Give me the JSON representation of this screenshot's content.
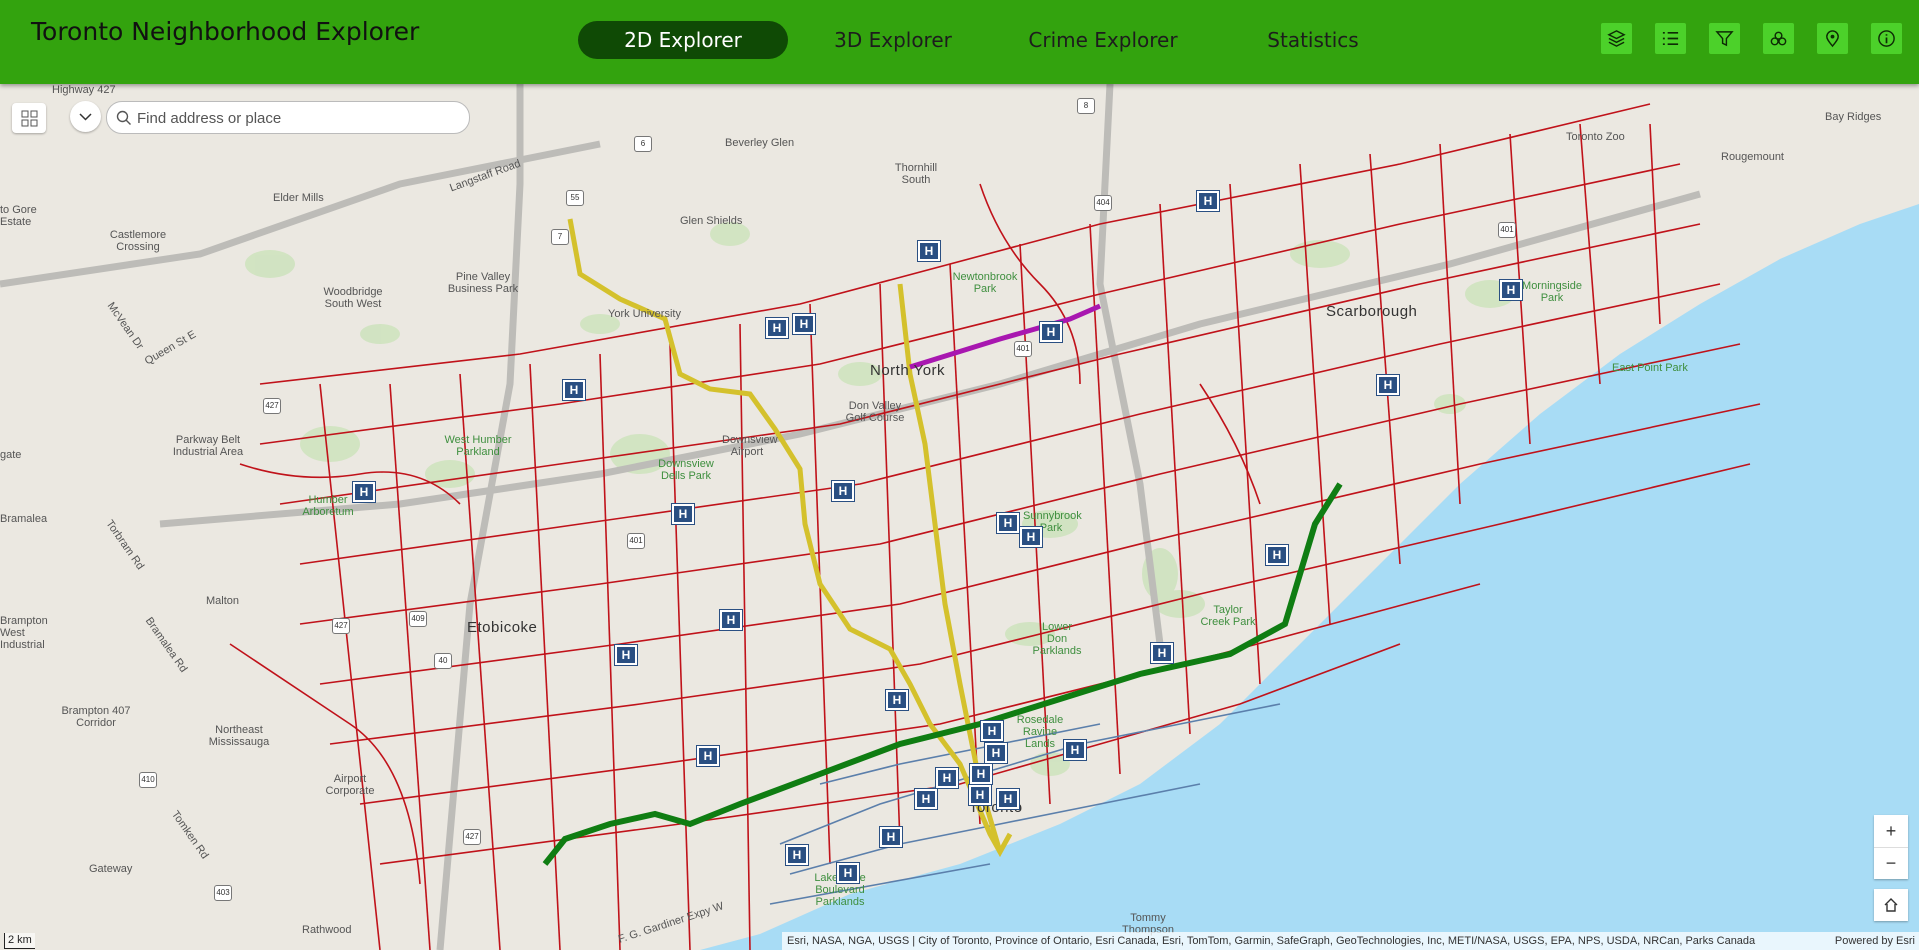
{
  "header": {
    "title": "Toronto Neighborhood Explorer",
    "tabs": [
      {
        "label": "2D Explorer",
        "active": true
      },
      {
        "label": "3D Explorer",
        "active": false
      },
      {
        "label": "Crime Explorer",
        "active": false
      },
      {
        "label": "Statistics",
        "active": false
      }
    ],
    "tools": [
      "layers-icon",
      "list-icon",
      "filter-icon",
      "cluster-icon",
      "location-pin-icon",
      "info-icon"
    ]
  },
  "search": {
    "placeholder": "Find address or place"
  },
  "zoom": {
    "in_label": "+",
    "out_label": "−"
  },
  "scale": {
    "label": "2 km"
  },
  "attribution": {
    "text": "Esri, NASA, NGA, USGS | City of Toronto, Province of Ontario, Esri Canada, Esri, TomTom, Garmin, SafeGraph, GeoTechnologies, Inc, METI/NASA, USGS, EPA, NPS, USDA, NRCan, Parks Canada",
    "powered": "Powered by Esri"
  },
  "map_labels": {
    "toronto_zoo": "Toronto Zoo",
    "bay_ridges": "Bay Ridges",
    "rougemount": "Rougemount",
    "scarborough": "Scarborough",
    "north_york": "North York",
    "etobicoke": "Etobicoke",
    "toronto": "Toronto",
    "bramalea": "Bramalea",
    "malton": "Malton",
    "elder_mills": "Elder Mills",
    "castlemore": "Castlemore Crossing",
    "woodbridge": "Woodbridge South West",
    "pine_valley": "Pine Valley Business Park",
    "glen_shields": "Glen Shields",
    "beverley_glen": "Beverley Glen",
    "thornhill_south": "Thornhill South",
    "thornhill": "Thornhill",
    "york_university": "York University",
    "newtonbrook": "Newtonbrook Park",
    "don_valley_golf": "Don Valley Golf Course",
    "downsview_airport": "Downsview Airport",
    "downsview_dells": "Downsview Dells Park",
    "west_humber": "West Humber Parkland",
    "humber_arboretum": "Humber Arboretum",
    "parkway_belt": "Parkway Belt Industrial Area",
    "sunnybrook": "Sunnybrook Park",
    "taylor_creek": "Taylor Creek Park",
    "lower_don": "Lower Don Parklands",
    "rosedale": "Rosedale Ravine Lands",
    "east_point": "East Point Park",
    "morningside": "Morningside Park",
    "brampton_407": "Brampton 407 Corridor",
    "brampton_west": "Brampton West Industrial",
    "northeast_mississauga": "Northeast Mississauga",
    "airport_corporate": "Airport Corporate",
    "gateway": "Gateway",
    "rathwood": "Rathwood",
    "lakeshore": "Lakeshore Boulevard Parklands",
    "tommy_thompson": "Tommy Thompson",
    "highway_427": "Highway 427",
    "queen_st": "Queen St E",
    "langstaff": "Langstaff Road",
    "mcvean": "McVean Dr",
    "torbram": "Torbram Rd",
    "bramalea_rd": "Bramalea Rd",
    "tomken": "Tomken Rd",
    "gardiner": "F. G. Gardiner Expy W",
    "to_gore": "to Gore Estate",
    "gate": "gate"
  },
  "hospital_symbol": "H",
  "highway_shields": [
    "427",
    "55",
    "7",
    "6",
    "8",
    "404",
    "401",
    "401",
    "401",
    "409",
    "427",
    "410",
    "403",
    "40",
    "427"
  ],
  "colors": {
    "header_bg": "#33a30e",
    "active_tab": "#0f4a05",
    "tool_button": "#4cd12a",
    "roads": "#c0121a",
    "subway_yellow": "#d4c12c",
    "subway_green": "#0f7d12",
    "subway_purple": "#a817b0",
    "streetcar": "#5b7fab",
    "water": "#a8dcf5",
    "hospital": "#2a4f82"
  }
}
